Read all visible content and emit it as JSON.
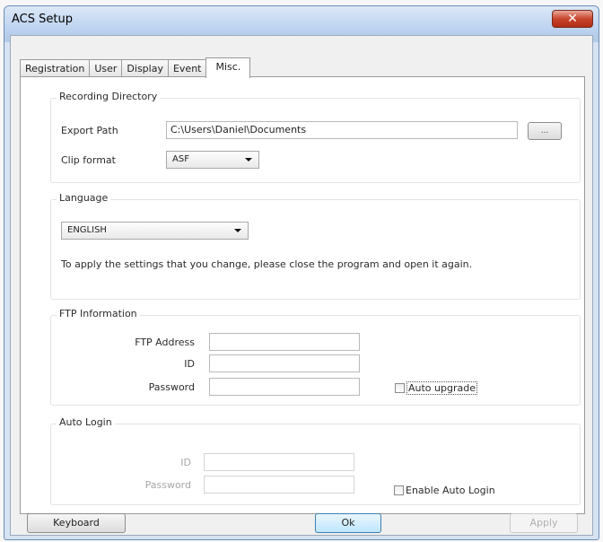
{
  "window": {
    "title": "ACS Setup",
    "close_glyph": "✕"
  },
  "tabs": [
    {
      "label": "Registration",
      "active": false
    },
    {
      "label": "User",
      "active": false
    },
    {
      "label": "Display",
      "active": false
    },
    {
      "label": "Event",
      "active": false
    },
    {
      "label": "Misc.",
      "active": true
    }
  ],
  "recording": {
    "title": "Recording Directory",
    "export_path_label": "Export Path",
    "export_path_value": "C:\\Users\\Daniel\\Documents",
    "browse_label": "...",
    "clip_format_label": "Clip format",
    "clip_format_value": "ASF"
  },
  "language": {
    "title": "Language",
    "selected": "ENGLISH",
    "note": "To apply the settings that you change, please close the program and open it again."
  },
  "ftp": {
    "title": "FTP Information",
    "address_label": "FTP Address",
    "address_value": "",
    "id_label": "ID",
    "id_value": "",
    "password_label": "Password",
    "password_value": "",
    "auto_upgrade_label": "Auto upgrade",
    "auto_upgrade_checked": false
  },
  "auto_login": {
    "title": "Auto Login",
    "id_label": "ID",
    "id_value": "",
    "password_label": "Password",
    "password_value": "",
    "enable_label": "Enable Auto Login",
    "enable_checked": false
  },
  "footer": {
    "keyboard_label": "Keyboard",
    "ok_label": "Ok",
    "apply_label": "Apply"
  },
  "icons": {
    "close": "close-icon",
    "dropdown": "chevron-down-icon"
  }
}
